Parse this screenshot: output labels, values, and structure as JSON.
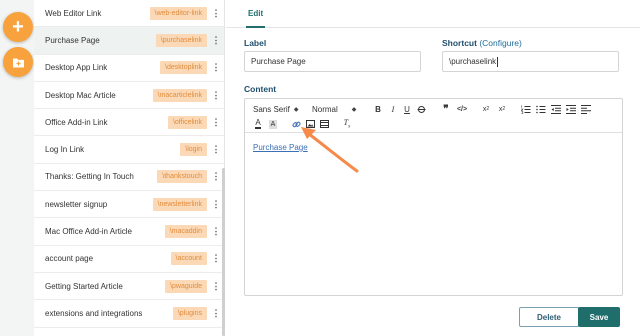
{
  "rail": {
    "add_icon": "plus-icon",
    "folder_icon": "folder-plus-icon",
    "accent_color": "#f7a23c"
  },
  "snippets": [
    {
      "name": "Web Editor Link",
      "shortcut": "\\web-editor-link"
    },
    {
      "name": "Purchase Page",
      "shortcut": "\\purchaselink"
    },
    {
      "name": "Desktop App Link",
      "shortcut": "\\desktoplink"
    },
    {
      "name": "Desktop Mac Article",
      "shortcut": "\\macarticlelink"
    },
    {
      "name": "Office Add-in Link",
      "shortcut": "\\officelink"
    },
    {
      "name": "Log In Link",
      "shortcut": "\\login"
    },
    {
      "name": "Thanks: Getting In Touch",
      "shortcut": "\\thankstouch"
    },
    {
      "name": "newsletter signup",
      "shortcut": "\\newsletterlink"
    },
    {
      "name": "Mac Office Add-in Article",
      "shortcut": "\\macaddin"
    },
    {
      "name": "account page",
      "shortcut": "\\account"
    },
    {
      "name": "Getting Started Article",
      "shortcut": "\\pwaguide"
    },
    {
      "name": "extensions and integrations",
      "shortcut": "\\plugins"
    }
  ],
  "active_index": 1,
  "editor": {
    "tab_label": "Edit",
    "label_heading": "Label",
    "label_value": "Purchase Page",
    "shortcut_heading": "Shortcut",
    "configure_link": "(Configure)",
    "shortcut_value": "\\purchaselink",
    "content_heading": "Content",
    "font_select": "Sans Serif",
    "size_select": "Normal",
    "content_link_text": "Purchase Page",
    "delete_label": "Delete",
    "save_label": "Save"
  },
  "colors": {
    "primary": "#1f6e6c",
    "shortcut_bg": "#fcd9b6",
    "arrow": "#f58a4b",
    "link": "#3b6fb6"
  }
}
